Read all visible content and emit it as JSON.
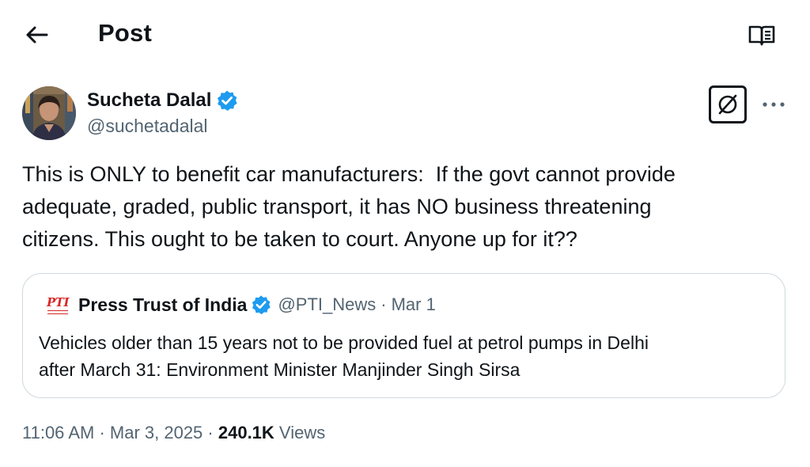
{
  "header": {
    "title": "Post",
    "back_icon": "arrow-left-icon",
    "reader_icon": "open-book-icon"
  },
  "author": {
    "name": "Sucheta Dalal",
    "handle": "@suchetadalal",
    "verified_color": "#1d9bf0"
  },
  "tweet": {
    "text": "This is ONLY to benefit car manufacturers:  If the govt cannot provide\nadequate, graded, public transport, it has NO business threatening\ncitizens. This ought to be taken to court. Anyone up for it??"
  },
  "quote": {
    "logo_text": "PTI",
    "name": "Press Trust of India",
    "handle": "@PTI_News",
    "separator": "·",
    "date": "Mar 1",
    "text": "Vehicles older than 15 years not to be provided fuel at petrol pumps in Delhi\nafter March 31: Environment Minister Manjinder Singh Sirsa"
  },
  "meta": {
    "time": "11:06 AM",
    "sep1": " · ",
    "date": "Mar 3, 2025",
    "sep2": " · ",
    "views_count": "240.1K",
    "views_label": " Views"
  },
  "colors": {
    "text": "#0f1419",
    "secondary": "#536471",
    "border": "#cfd9de",
    "accent": "#1d9bf0",
    "pti_red": "#d62828"
  }
}
